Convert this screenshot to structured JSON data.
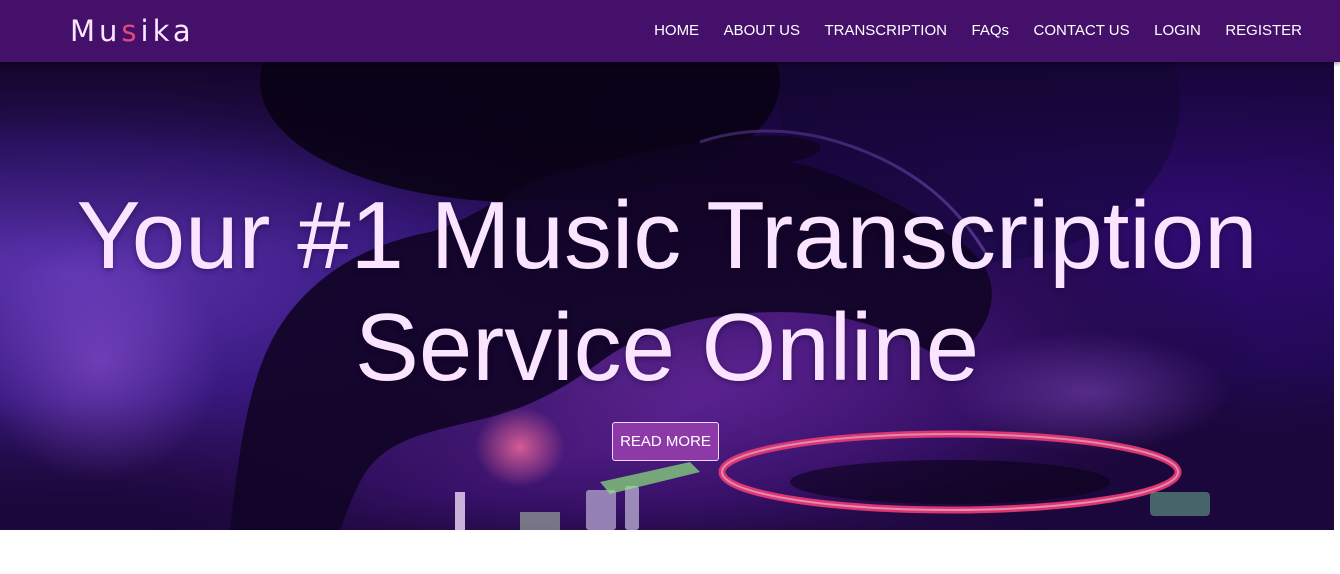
{
  "brand": {
    "prefix": "Mu",
    "accent": "s",
    "suffix": "ika"
  },
  "nav": {
    "items": [
      {
        "label": "HOME"
      },
      {
        "label": "ABOUT US"
      },
      {
        "label": "TRANSCRIPTION"
      },
      {
        "label": "FAQs"
      },
      {
        "label": "CONTACT US"
      },
      {
        "label": "LOGIN"
      },
      {
        "label": "REGISTER"
      }
    ]
  },
  "hero": {
    "title_line1": "Your #1 Music Transcription",
    "title_line2": "Service Online",
    "cta_label": "READ MORE",
    "image_subject": "dj-turntable-hand-photo"
  },
  "colors": {
    "navbar_bg": "#45106a",
    "brand_text": "#fbe7ff",
    "brand_accent": "#e24a7d",
    "hero_text": "#fbe4ff",
    "cta_bg": "#8d3aa8"
  }
}
